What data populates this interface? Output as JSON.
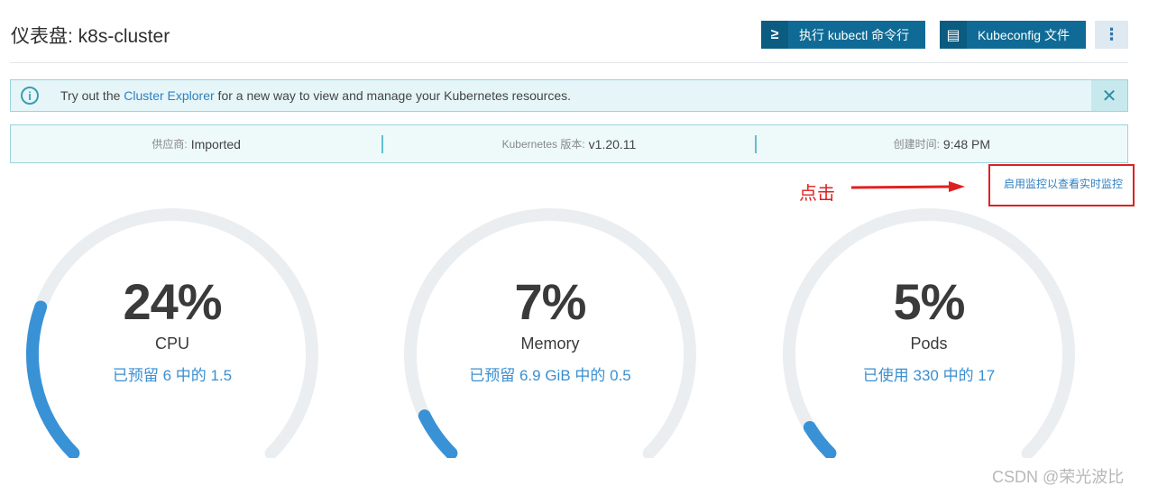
{
  "page": {
    "title": "仪表盘: k8s-cluster",
    "buttons": {
      "kubectl": {
        "icon": "terminal-icon",
        "icon_glyph": "≥",
        "label": "执行 kubectl 命令行"
      },
      "kubeconfig": {
        "icon": "file-icon",
        "icon_glyph": "▤",
        "label": "Kubeconfig 文件"
      },
      "more": {
        "icon": "more-vertical-icon",
        "icon_glyph": "⋮"
      }
    }
  },
  "banner": {
    "icon": "info-icon",
    "icon_glyph": "i",
    "prefix": "Try out the ",
    "link": "Cluster Explorer",
    "suffix": " for a new way to view and manage your Kubernetes resources.",
    "close_glyph": "✕"
  },
  "meta": {
    "provider_label": "供应商:",
    "provider_value": "Imported",
    "version_label": "Kubernetes 版本:",
    "version_value": "v1.20.11",
    "created_label": "创建时间:",
    "created_value": "9:48 PM"
  },
  "annotation": {
    "text": "点击",
    "link": "启用监控以查看实时监控"
  },
  "gauges": [
    {
      "percent": "24%",
      "name": "CPU",
      "sub": "已预留 6 中的 1.5",
      "fill": 0.24
    },
    {
      "percent": "7%",
      "name": "Memory",
      "sub": "已预留 6.9 GiB 中的 0.5",
      "fill": 0.07
    },
    {
      "percent": "5%",
      "name": "Pods",
      "sub": "已使用 330 中的 17",
      "fill": 0.05
    }
  ],
  "colors": {
    "gauge_track": "#ebeef0",
    "gauge_fill": "#3a92d6",
    "primary_button": "#0f6b95",
    "annotation": "#e02020"
  },
  "watermark": "CSDN @荣光波比"
}
